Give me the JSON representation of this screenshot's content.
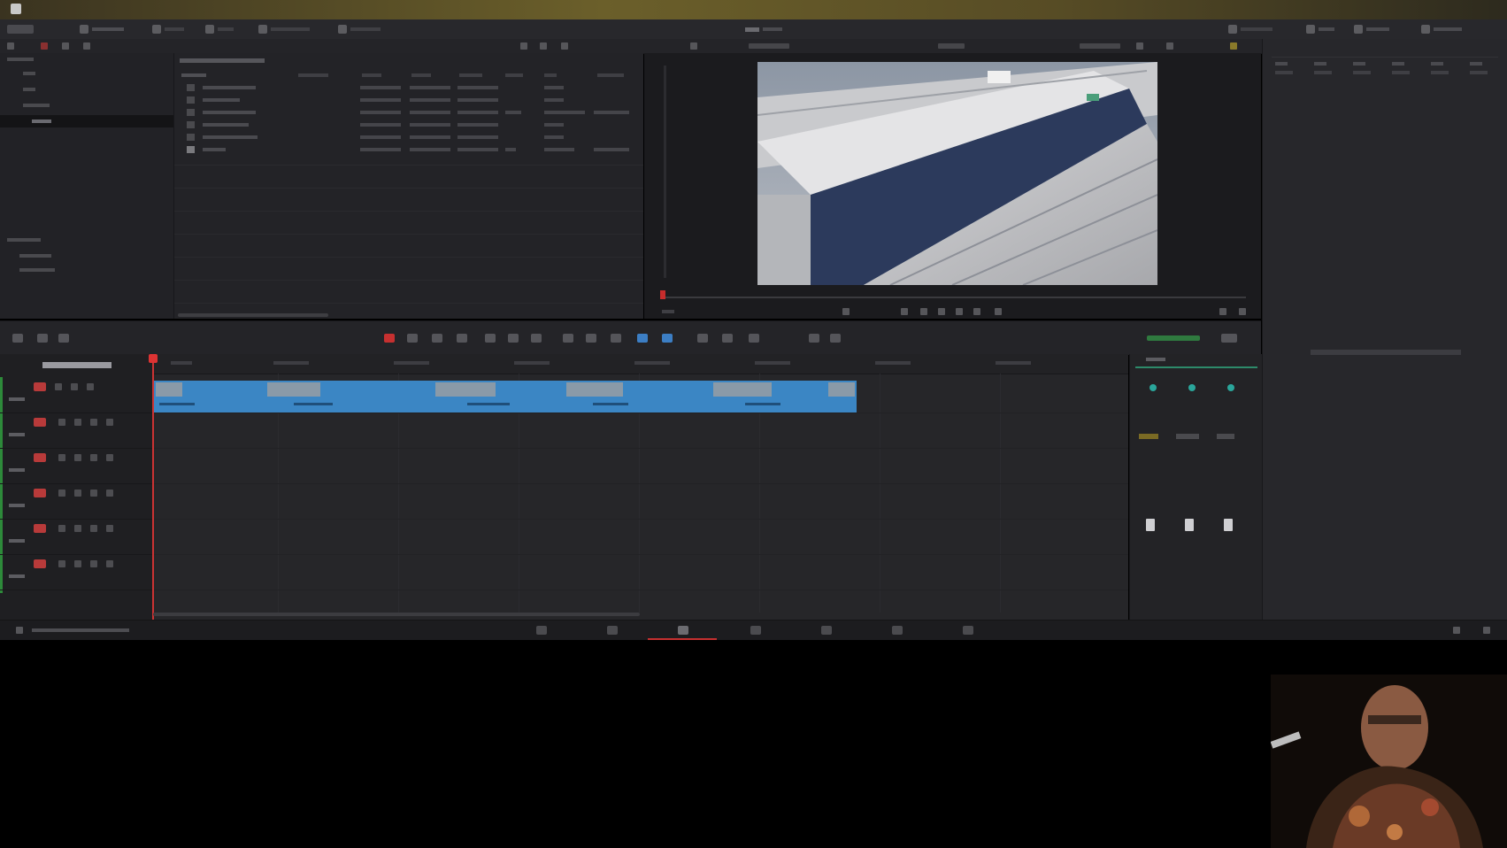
{
  "toolbar": {
    "items": [
      "",
      "",
      "",
      "",
      ""
    ],
    "right_items": [
      "",
      "",
      "",
      ""
    ]
  },
  "media": {
    "clip_rows": 6
  },
  "timeline": {
    "tracks": 6,
    "clips": 5
  },
  "pages": 7,
  "colors": {
    "clip_blue": "#3b86c4",
    "playhead_red": "#cc3333",
    "track_green": "#2d8a3a",
    "knob_teal": "#2aa69b"
  }
}
